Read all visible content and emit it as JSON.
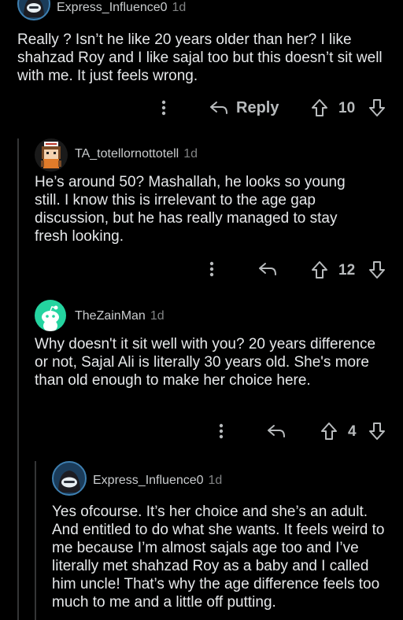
{
  "colors": {
    "background": "#000000",
    "text": "#e6e8ea",
    "muted": "#818384",
    "thread_line": "#343536",
    "zain_avatar": "#24d4a0"
  },
  "comments": [
    {
      "username": "Express_Influence0",
      "age": "1d",
      "avatar_icon": "hooded-robot-avatar-icon",
      "text": "Really ? Isn’t he like 20 years older than her? I like shahzad Roy and I like sajal too but this doesn’t sit well with me. It just feels wrong.",
      "reply_label": "Reply",
      "votes": "10"
    },
    {
      "username": "TA_totellornottotell",
      "age": "1d",
      "avatar_icon": "pixel-character-avatar-icon",
      "text": "He’s around 50? Mashallah, he looks so young still. I know this is irrelevant to the age gap discussion, but he has really managed to stay fresh looking.",
      "votes": "12"
    },
    {
      "username": "TheZainMan",
      "age": "1d",
      "avatar_icon": "snoo-avatar-icon",
      "text": "Why doesn't it sit well with you? 20 years difference or not, Sajal Ali is literally 30 years old. She's more than old enough to make her choice here.",
      "votes": "4"
    },
    {
      "username": "Express_Influence0",
      "age": "1d",
      "avatar_icon": "hooded-robot-avatar-icon",
      "text": "Yes ofcourse. It’s her choice and she’s an adult. And entitled to do what she wants. It feels weird to me because I’m almost sajals age too and I’ve literally met shahzad Roy as a baby and I called him uncle! That’s why the age difference feels too much to me and a little off putting."
    }
  ]
}
